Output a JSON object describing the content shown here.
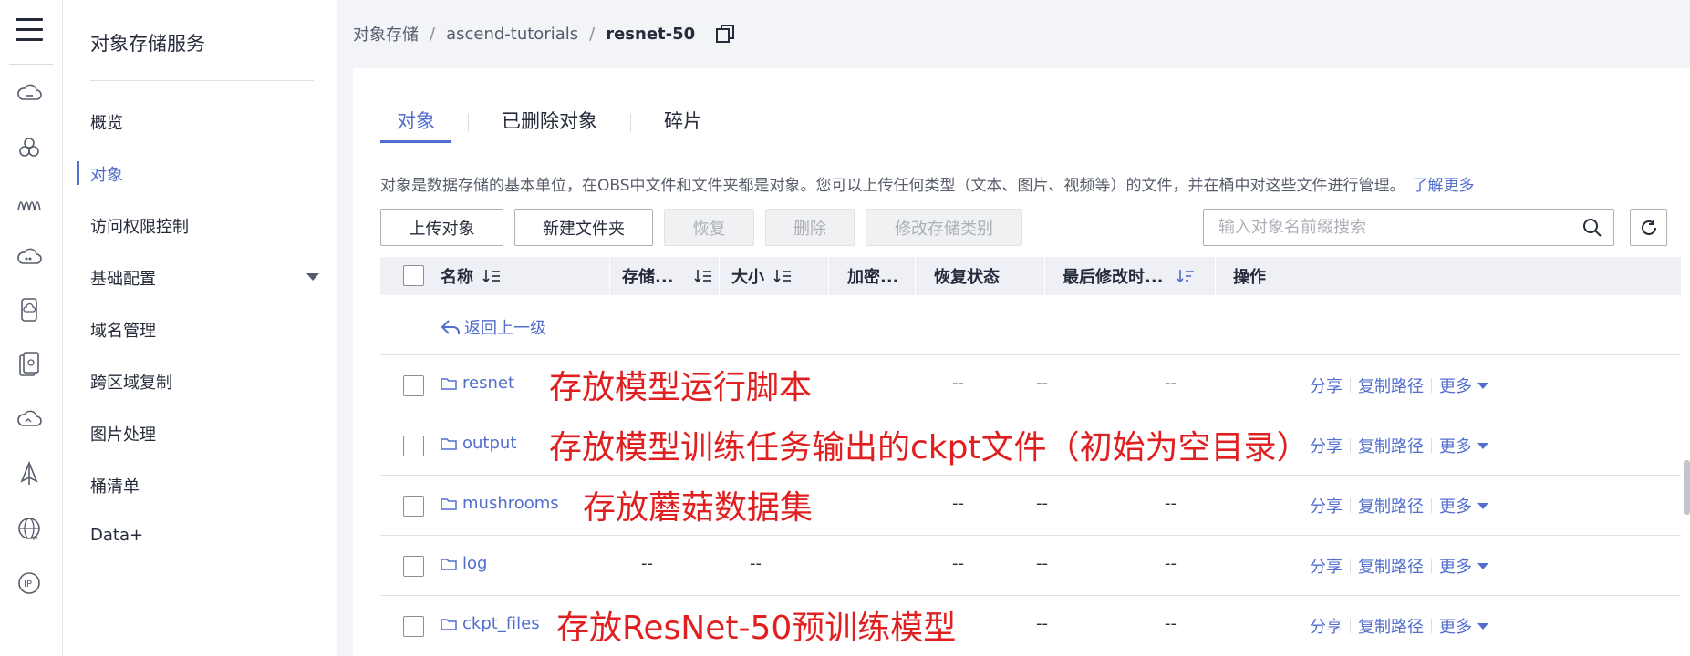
{
  "sidebar": {
    "title": "对象存储服务",
    "items": [
      {
        "label": "概览"
      },
      {
        "label": "对象"
      },
      {
        "label": "访问权限控制"
      },
      {
        "label": "基础配置"
      },
      {
        "label": "域名管理"
      },
      {
        "label": "跨区域复制"
      },
      {
        "label": "图片处理"
      },
      {
        "label": "桶清单"
      },
      {
        "label": "Data+"
      }
    ]
  },
  "breadcrumb": {
    "root": "对象存储",
    "bucket": "ascend-tutorials",
    "current": "resnet-50",
    "sep": "/"
  },
  "tabs": [
    {
      "label": "对象"
    },
    {
      "label": "已删除对象"
    },
    {
      "label": "碎片"
    }
  ],
  "description": {
    "text": "对象是数据存储的基本单位，在OBS中文件和文件夹都是对象。您可以上传任何类型（文本、图片、视频等）的文件，并在桶中对这些文件进行管理。",
    "link": "了解更多"
  },
  "toolbar": {
    "upload": "上传对象",
    "new_folder": "新建文件夹",
    "restore": "恢复",
    "delete": "删除",
    "change_class": "修改存储类别"
  },
  "search": {
    "placeholder": "输入对象名前缀搜索"
  },
  "table": {
    "headers": {
      "name": "名称",
      "storage": "存储...",
      "size": "大小",
      "encryption": "加密...",
      "restore_status": "恢复状态",
      "modified": "最后修改时...",
      "actions": "操作"
    },
    "back": "返回上一级",
    "rows": [
      {
        "name": "resnet",
        "storage": "",
        "size": "",
        "enc": "--",
        "restore": "--",
        "modified": "--",
        "note": "存放模型运行脚本"
      },
      {
        "name": "output",
        "storage": "",
        "size": "",
        "enc": "",
        "restore": "",
        "modified": "",
        "note": "存放模型训练任务输出的ckpt文件（初始为空目录）"
      },
      {
        "name": "mushrooms",
        "storage": "",
        "size": "",
        "enc": "--",
        "restore": "--",
        "modified": "--",
        "note": "存放蘑菇数据集"
      },
      {
        "name": "log",
        "storage": "--",
        "size": "--",
        "enc": "--",
        "restore": "--",
        "modified": "--",
        "note": ""
      },
      {
        "name": "ckpt_files",
        "storage": "",
        "size": "",
        "enc": "",
        "restore": "--",
        "modified": "--",
        "note": "存放ResNet-50预训练模型"
      }
    ],
    "ops": {
      "share": "分享",
      "copy_path": "复制路径",
      "more": "更多"
    }
  },
  "colors": {
    "accent": "#526ecc",
    "annotation": "#e02020"
  }
}
